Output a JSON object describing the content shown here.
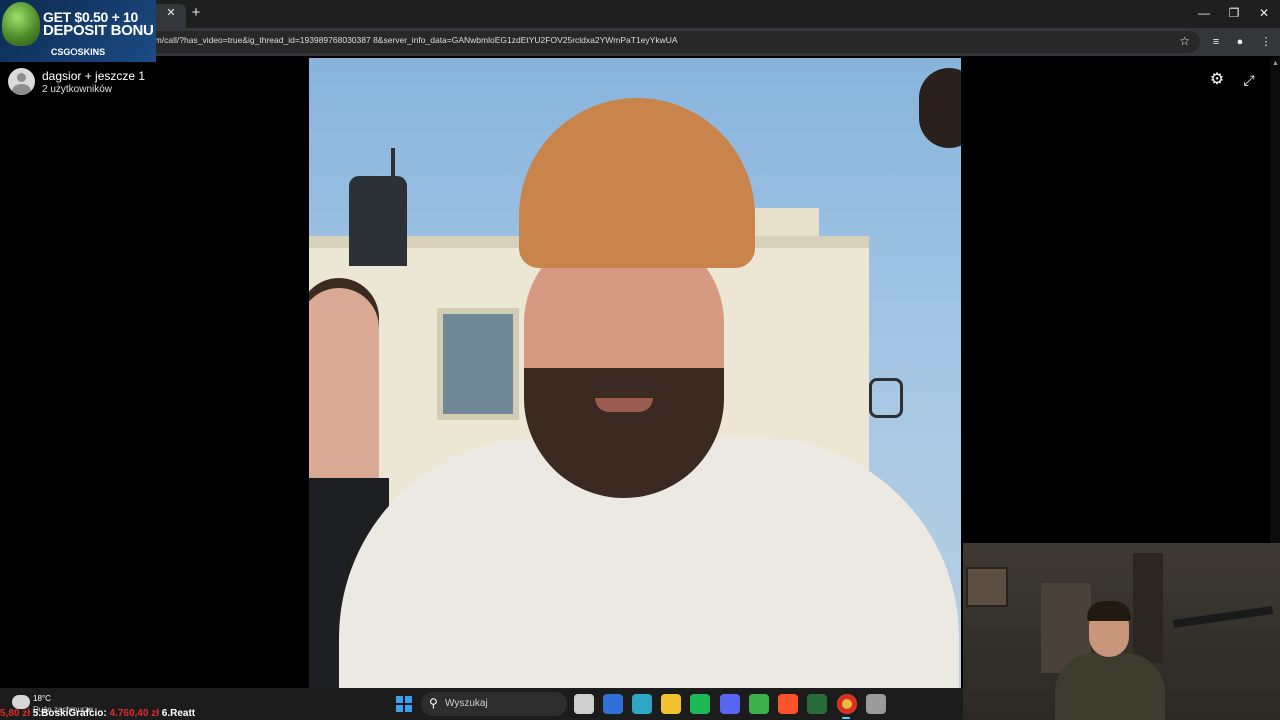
{
  "ad": {
    "line1": "GET $0.50 + 10",
    "line2": "DEPOSIT BONU",
    "brand": "CSG⭘SKINS"
  },
  "browser": {
    "url": "om/call/?has_video=true&ig_thread_id=193989768030387 8&server_info_data=GANwbmloEG1zdEtYU2FOV25rcldxa2YWmPaT1eyYkwUA",
    "tab_close": "✕",
    "new_tab": "+",
    "min": "—",
    "restore": "❐",
    "close": "✕",
    "star": "☆",
    "icons": [
      "queue-icon",
      "profile-icon",
      "menu-icon"
    ]
  },
  "call": {
    "title": "dagsior + jeszcze 1",
    "subtitle": "2 użytkowników"
  },
  "taskbar": {
    "temp": "18°C",
    "weather": "Duże zachmurze",
    "ticker": [
      {
        "text": "5,80 zł",
        "color": "r"
      },
      {
        "text": " 5.BoskiGrafcio: ",
        "color": "w"
      },
      {
        "text": "4.760,40 zł",
        "color": "r"
      },
      {
        "text": " 6.Reatt",
        "color": "w"
      }
    ],
    "search_placeholder": "Wyszukaj",
    "apps": [
      {
        "name": "task-view-icon",
        "color": "#cfcfcf"
      },
      {
        "name": "store-icon",
        "color": "#2f6fd6"
      },
      {
        "name": "edge-icon",
        "color": "#2fa6c8"
      },
      {
        "name": "file-explorer-icon",
        "color": "#f2c230"
      },
      {
        "name": "spotify-icon",
        "color": "#1db954"
      },
      {
        "name": "discord-icon",
        "color": "#5865f2"
      },
      {
        "name": "green-browser-icon",
        "color": "#3cb04a"
      },
      {
        "name": "brave-icon",
        "color": "#fb542b"
      },
      {
        "name": "xbox-icon",
        "color": "#2a6b3a"
      },
      {
        "name": "chrome-icon",
        "color": "#e8b93c"
      },
      {
        "name": "obs-icon",
        "color": "#9a9a9a"
      }
    ]
  }
}
